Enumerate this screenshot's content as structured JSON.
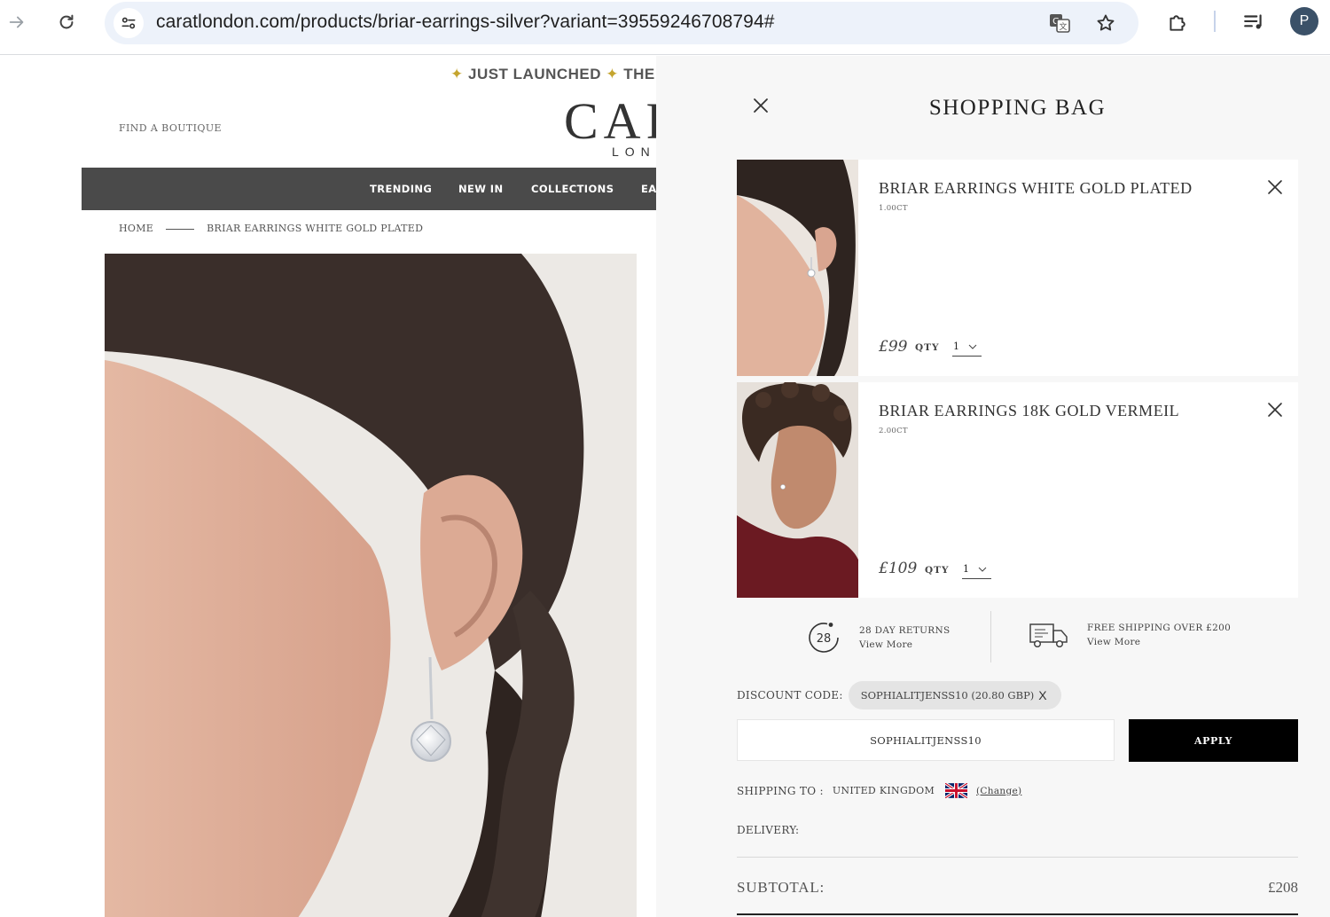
{
  "browser": {
    "url": "caratlondon.com/products/briar-earrings-silver?variant=39559246708794#",
    "profile_initial": "P"
  },
  "store": {
    "announcement": "JUST LAUNCHED",
    "announcement_cut": "THE",
    "find_boutique": "FIND A BOUTIQUE",
    "logo": "CAR",
    "logo_sub": "LON",
    "nav": [
      "TRENDING",
      "NEW IN",
      "COLLECTIONS",
      "EA"
    ],
    "breadcrumb": {
      "home": "HOME",
      "current": "BRIAR EARRINGS WHITE GOLD PLATED"
    }
  },
  "bag": {
    "title": "SHOPPING BAG",
    "items": [
      {
        "name": "BRIAR EARRINGS WHITE GOLD PLATED",
        "carat": "1.00CT",
        "price": "£99",
        "qty_label": "QTY",
        "qty": "1"
      },
      {
        "name": "BRIAR EARRINGS 18K GOLD VERMEIL",
        "carat": "2.00CT",
        "price": "£109",
        "qty_label": "QTY",
        "qty": "1"
      }
    ],
    "perks": {
      "returns_badge": "28",
      "returns_title": "28 DAY RETURNS",
      "returns_link": "View More",
      "shipping_title": "FREE SHIPPING OVER £200",
      "shipping_link": "View More"
    },
    "discount": {
      "label": "DISCOUNT CODE:",
      "applied": "SOPHIALITJENSS10 (20.80 GBP)",
      "remove": "X",
      "input_value": "SOPHIALITJENSS10",
      "apply_label": "APPLY"
    },
    "shipping": {
      "label": "SHIPPING TO :",
      "country": "UNITED KINGDOM",
      "change": "(Change)"
    },
    "delivery_label": "DELIVERY:",
    "subtotal_label": "SUBTOTAL:",
    "subtotal_value": "£208"
  },
  "colors": {
    "nav_bar": "#4a4a4a",
    "drawer_bg": "#f7f7f7",
    "apply_button": "#000000"
  },
  "icons": [
    "back-arrow-icon",
    "reload-icon",
    "site-settings-icon",
    "translate-icon",
    "bookmark-star-icon",
    "extensions-icon",
    "reading-list-icon",
    "close-icon",
    "returns-28-icon",
    "delivery-truck-icon",
    "uk-flag-icon",
    "chevron-down-icon"
  ]
}
